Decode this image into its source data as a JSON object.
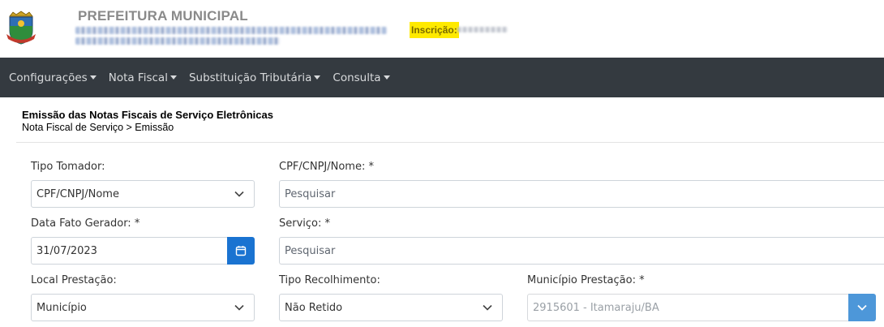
{
  "header": {
    "org_title": "PREFEITURA MUNICIPAL",
    "inscricao_label": "Inscrição:"
  },
  "navbar": {
    "items": [
      {
        "label": "Configurações"
      },
      {
        "label": "Nota Fiscal"
      },
      {
        "label": "Substituição Tributária"
      },
      {
        "label": "Consulta"
      }
    ]
  },
  "page": {
    "title": "Emissão das Notas Fiscais de Serviço Eletrônicas",
    "breadcrumb": "Nota Fiscal de Serviço > Emissão"
  },
  "form": {
    "tipo_tomador": {
      "label": "Tipo Tomador:",
      "value": "CPF/CNPJ/Nome"
    },
    "cpf_cnpj_nome": {
      "label": "CPF/CNPJ/Nome: *",
      "placeholder": "Pesquisar"
    },
    "data_fato_gerador": {
      "label": "Data Fato Gerador: *",
      "value": "31/07/2023"
    },
    "servico": {
      "label": "Serviço: *",
      "placeholder": "Pesquisar"
    },
    "local_prestacao": {
      "label": "Local Prestação:",
      "value": "Município"
    },
    "tipo_recolhimento": {
      "label": "Tipo Recolhimento:",
      "value": "Não Retido"
    },
    "municipio_prestacao": {
      "label": "Município Prestação: *",
      "value": "2915601 - Itamaraju/BA"
    }
  },
  "colors": {
    "navbar_bg": "#343a40",
    "primary": "#1a73d1",
    "highlight": "#ffea00"
  }
}
